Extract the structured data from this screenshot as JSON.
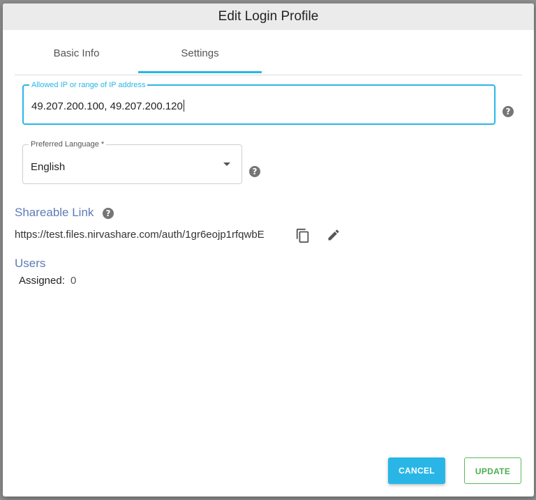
{
  "dialog": {
    "title": "Edit Login Profile",
    "tabs": [
      {
        "label": "Basic Info",
        "active": false
      },
      {
        "label": "Settings",
        "active": true
      }
    ]
  },
  "ip_field": {
    "label": "Allowed IP or range of IP address",
    "value": "49.207.200.100, 49.207.200.120"
  },
  "language_field": {
    "label": "Preferred Language *",
    "value": "English"
  },
  "shareable_link": {
    "heading": "Shareable Link",
    "url": "https://test.files.nirvashare.com/auth/1gr6eojp1rfqwbE"
  },
  "users": {
    "heading": "Users",
    "assigned_label": "Assigned:",
    "assigned_count": "0"
  },
  "actions": {
    "cancel_label": "CANCEL",
    "update_label": "UPDATE"
  },
  "icons": {
    "help": "help-circle-icon",
    "copy": "copy-icon",
    "edit": "pencil-icon",
    "dropdown": "caret-down-icon"
  },
  "colors": {
    "accent": "#29b6e6",
    "section_title": "#5d7bb8",
    "update_green": "#4caf50"
  }
}
